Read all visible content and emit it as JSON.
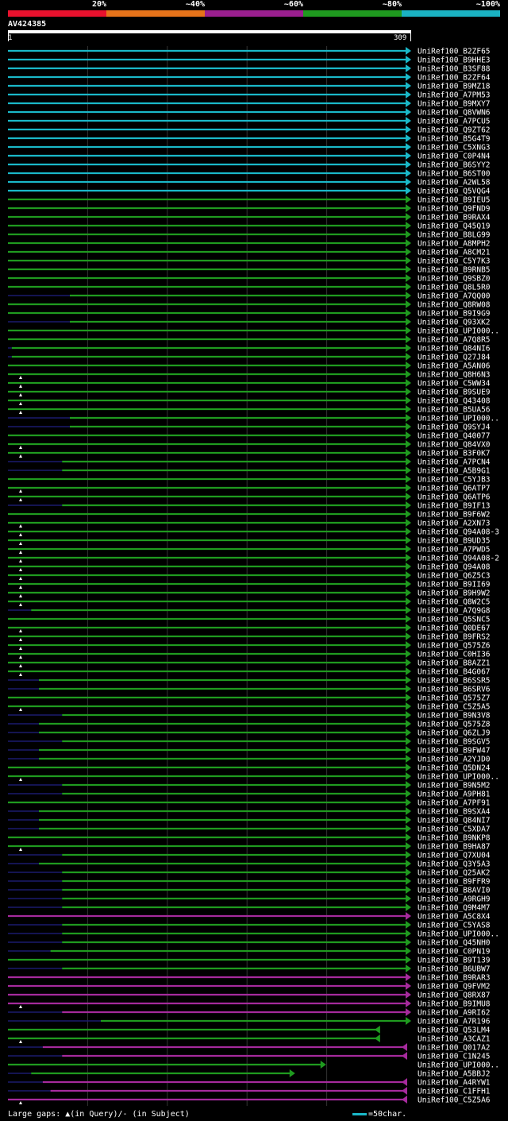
{
  "legend": {
    "labels": [
      "20%",
      "~40%",
      "~60%",
      "~80%",
      "~100%"
    ],
    "colors": [
      "#e8112d",
      "#e6731a",
      "#9b1f8f",
      "#1f9a1f",
      "#1ab2c2"
    ]
  },
  "query": {
    "name": "AV424385",
    "start": "1",
    "end": "309"
  },
  "colors": {
    "cyan": "#1ab8c8",
    "green": "#1f9a1f",
    "magenta": "#a52a9c",
    "gap": "#1a1a6e"
  },
  "hits": [
    {
      "name": "UniRef100_B2ZF65",
      "c": "cyan",
      "s": 0,
      "e": 309,
      "a": "r"
    },
    {
      "name": "UniRef100_B9HHE3",
      "c": "cyan",
      "s": 0,
      "e": 309,
      "a": "r"
    },
    {
      "name": "UniRef100_B3SF88",
      "c": "cyan",
      "s": 0,
      "e": 309,
      "a": "r"
    },
    {
      "name": "UniRef100_B2ZF64",
      "c": "cyan",
      "s": 0,
      "e": 309,
      "a": "r"
    },
    {
      "name": "UniRef100_B9MZ18",
      "c": "cyan",
      "s": 0,
      "e": 309,
      "a": "r"
    },
    {
      "name": "UniRef100_A7PM53",
      "c": "cyan",
      "s": 0,
      "e": 309,
      "a": "r"
    },
    {
      "name": "UniRef100_B9MXY7",
      "c": "cyan",
      "s": 0,
      "e": 309,
      "a": "r"
    },
    {
      "name": "UniRef100_Q8VWN6",
      "c": "cyan",
      "s": 0,
      "e": 309,
      "a": "r"
    },
    {
      "name": "UniRef100_A7PCU5",
      "c": "cyan",
      "s": 0,
      "e": 309,
      "a": "r"
    },
    {
      "name": "UniRef100_Q9ZT62",
      "c": "cyan",
      "s": 0,
      "e": 309,
      "a": "r"
    },
    {
      "name": "UniRef100_B5G4T9",
      "c": "cyan",
      "s": 0,
      "e": 309,
      "a": "r"
    },
    {
      "name": "UniRef100_C5XNG3",
      "c": "cyan",
      "s": 0,
      "e": 309,
      "a": "r"
    },
    {
      "name": "UniRef100_C0P4N4",
      "c": "cyan",
      "s": 0,
      "e": 309,
      "a": "r"
    },
    {
      "name": "UniRef100_B6SYY2",
      "c": "cyan",
      "s": 0,
      "e": 309,
      "a": "r"
    },
    {
      "name": "UniRef100_B6ST00",
      "c": "cyan",
      "s": 0,
      "e": 309,
      "a": "r"
    },
    {
      "name": "UniRef100_A2WL58",
      "c": "cyan",
      "s": 0,
      "e": 309,
      "a": "r"
    },
    {
      "name": "UniRef100_Q5VQG4",
      "c": "cyan",
      "s": 0,
      "e": 309,
      "a": "r"
    },
    {
      "name": "UniRef100_B9IEU5",
      "c": "green",
      "s": 0,
      "e": 309,
      "a": "r"
    },
    {
      "name": "UniRef100_Q9FND9",
      "c": "green",
      "s": 0,
      "e": 309,
      "a": "r"
    },
    {
      "name": "UniRef100_B9RAX4",
      "c": "green",
      "s": 0,
      "e": 309,
      "a": "r"
    },
    {
      "name": "UniRef100_Q45Q19",
      "c": "green",
      "s": 0,
      "e": 309,
      "a": "r"
    },
    {
      "name": "UniRef100_B8LG99",
      "c": "green",
      "s": 0,
      "e": 309,
      "a": "r"
    },
    {
      "name": "UniRef100_A8MPH2",
      "c": "green",
      "s": 0,
      "e": 309,
      "a": "r"
    },
    {
      "name": "UniRef100_A8CM21",
      "c": "green",
      "s": 0,
      "e": 309,
      "a": "r"
    },
    {
      "name": "UniRef100_C5Y7K3",
      "c": "green",
      "s": 0,
      "e": 309,
      "a": "r"
    },
    {
      "name": "UniRef100_B9RNB5",
      "c": "green",
      "s": 0,
      "e": 309,
      "a": "r"
    },
    {
      "name": "UniRef100_Q9SBZ0",
      "c": "green",
      "s": 0,
      "e": 309,
      "a": "r"
    },
    {
      "name": "UniRef100_Q8L5R0",
      "c": "green",
      "s": 0,
      "e": 309,
      "a": "r"
    },
    {
      "name": "UniRef100_A7QQ00",
      "c": "green",
      "s": 48,
      "e": 309,
      "a": "r"
    },
    {
      "name": "UniRef100_Q8RW08",
      "c": "green",
      "s": 0,
      "e": 309,
      "a": "r"
    },
    {
      "name": "UniRef100_B9I9G9",
      "c": "green",
      "s": 0,
      "e": 309,
      "a": "r"
    },
    {
      "name": "UniRef100_Q93XK2",
      "c": "green",
      "s": 48,
      "e": 309,
      "a": "r"
    },
    {
      "name": "UniRef100_UPI000..",
      "c": "green",
      "s": 0,
      "e": 309,
      "a": "r"
    },
    {
      "name": "UniRef100_A7Q8R5",
      "c": "green",
      "s": 0,
      "e": 309,
      "a": "r"
    },
    {
      "name": "UniRef100_Q84NI6",
      "c": "green",
      "s": 3,
      "e": 309,
      "a": "r"
    },
    {
      "name": "UniRef100_Q27J84",
      "c": "green",
      "s": 3,
      "e": 309,
      "a": "r"
    },
    {
      "name": "UniRef100_A5AN06",
      "c": "green",
      "s": 0,
      "e": 309,
      "a": "r"
    },
    {
      "name": "UniRef100_Q8H6N3",
      "c": "green",
      "s": 0,
      "e": 309,
      "a": "r",
      "g": 1
    },
    {
      "name": "UniRef100_C5WW34",
      "c": "green",
      "s": 0,
      "e": 309,
      "a": "r",
      "g": 1
    },
    {
      "name": "UniRef100_B9SUE9",
      "c": "green",
      "s": 0,
      "e": 309,
      "a": "r",
      "g": 1
    },
    {
      "name": "UniRef100_Q43408",
      "c": "green",
      "s": 0,
      "e": 309,
      "a": "r",
      "g": 1
    },
    {
      "name": "UniRef100_B5UA56",
      "c": "green",
      "s": 0,
      "e": 309,
      "a": "r",
      "g": 1
    },
    {
      "name": "UniRef100_UPI000..",
      "c": "green",
      "s": 48,
      "e": 309,
      "a": "r"
    },
    {
      "name": "UniRef100_Q9SYJ4",
      "c": "green",
      "s": 48,
      "e": 309,
      "a": "r"
    },
    {
      "name": "UniRef100_Q40077",
      "c": "green",
      "s": 0,
      "e": 309,
      "a": "r"
    },
    {
      "name": "UniRef100_Q84VX0",
      "c": "green",
      "s": 0,
      "e": 309,
      "a": "r",
      "g": 1
    },
    {
      "name": "UniRef100_B3F0K7",
      "c": "green",
      "s": 0,
      "e": 309,
      "a": "r",
      "g": 1
    },
    {
      "name": "UniRef100_A7PCN4",
      "c": "green",
      "s": 42,
      "e": 309,
      "a": "r"
    },
    {
      "name": "UniRef100_A5B9G1",
      "c": "green",
      "s": 42,
      "e": 309,
      "a": "r"
    },
    {
      "name": "UniRef100_C5YJB3",
      "c": "green",
      "s": 0,
      "e": 309,
      "a": "r"
    },
    {
      "name": "UniRef100_Q6ATP7",
      "c": "green",
      "s": 0,
      "e": 309,
      "a": "r",
      "g": 1
    },
    {
      "name": "UniRef100_Q6ATP6",
      "c": "green",
      "s": 0,
      "e": 309,
      "a": "r",
      "g": 1
    },
    {
      "name": "UniRef100_B9IF13",
      "c": "green",
      "s": 42,
      "e": 309,
      "a": "r"
    },
    {
      "name": "UniRef100_B9F6W2",
      "c": "green",
      "s": 0,
      "e": 309,
      "a": "r"
    },
    {
      "name": "UniRef100_A2XN73",
      "c": "green",
      "s": 0,
      "e": 309,
      "a": "r",
      "g": 1
    },
    {
      "name": "UniRef100_Q94A08-3",
      "c": "green",
      "s": 0,
      "e": 309,
      "a": "r",
      "g": 1
    },
    {
      "name": "UniRef100_B9UD35",
      "c": "green",
      "s": 0,
      "e": 309,
      "a": "r",
      "g": 1
    },
    {
      "name": "UniRef100_A7PWD5",
      "c": "green",
      "s": 0,
      "e": 309,
      "a": "r",
      "g": 1
    },
    {
      "name": "UniRef100_Q94A08-2",
      "c": "green",
      "s": 0,
      "e": 309,
      "a": "r",
      "g": 1
    },
    {
      "name": "UniRef100_Q94A08",
      "c": "green",
      "s": 0,
      "e": 309,
      "a": "r",
      "g": 1
    },
    {
      "name": "UniRef100_Q6Z5C3",
      "c": "green",
      "s": 0,
      "e": 309,
      "a": "r",
      "g": 1
    },
    {
      "name": "UniRef100_B9II69",
      "c": "green",
      "s": 0,
      "e": 309,
      "a": "r",
      "g": 1
    },
    {
      "name": "UniRef100_B9H9W2",
      "c": "green",
      "s": 0,
      "e": 309,
      "a": "r",
      "g": 1
    },
    {
      "name": "UniRef100_Q8W2C5",
      "c": "green",
      "s": 0,
      "e": 309,
      "a": "r",
      "g": 1
    },
    {
      "name": "UniRef100_A7Q9G8",
      "c": "green",
      "s": 18,
      "e": 309,
      "a": "r"
    },
    {
      "name": "UniRef100_Q5SNC5",
      "c": "green",
      "s": 0,
      "e": 309,
      "a": "r"
    },
    {
      "name": "UniRef100_Q0DE67",
      "c": "green",
      "s": 0,
      "e": 309,
      "a": "r",
      "g": 1
    },
    {
      "name": "UniRef100_B9FRS2",
      "c": "green",
      "s": 0,
      "e": 309,
      "a": "r",
      "g": 1
    },
    {
      "name": "UniRef100_Q575Z6",
      "c": "green",
      "s": 0,
      "e": 309,
      "a": "r",
      "g": 1
    },
    {
      "name": "UniRef100_C0HI36",
      "c": "green",
      "s": 0,
      "e": 309,
      "a": "r",
      "g": 1
    },
    {
      "name": "UniRef100_B8AZZ1",
      "c": "green",
      "s": 0,
      "e": 309,
      "a": "r",
      "g": 1
    },
    {
      "name": "UniRef100_B4G067",
      "c": "green",
      "s": 0,
      "e": 309,
      "a": "r",
      "g": 1
    },
    {
      "name": "UniRef100_B6SSR5",
      "c": "green",
      "s": 24,
      "e": 309,
      "a": "r"
    },
    {
      "name": "UniRef100_B6SRV6",
      "c": "green",
      "s": 24,
      "e": 309,
      "a": "r"
    },
    {
      "name": "UniRef100_Q575Z7",
      "c": "green",
      "s": 0,
      "e": 309,
      "a": "r"
    },
    {
      "name": "UniRef100_C5Z5A5",
      "c": "green",
      "s": 0,
      "e": 309,
      "a": "r",
      "g": 1
    },
    {
      "name": "UniRef100_B9N3V8",
      "c": "green",
      "s": 42,
      "e": 309,
      "a": "r"
    },
    {
      "name": "UniRef100_Q575Z8",
      "c": "green",
      "s": 24,
      "e": 309,
      "a": "r"
    },
    {
      "name": "UniRef100_Q6ZLJ9",
      "c": "green",
      "s": 24,
      "e": 309,
      "a": "r"
    },
    {
      "name": "UniRef100_B9SGV5",
      "c": "green",
      "s": 42,
      "e": 309,
      "a": "r"
    },
    {
      "name": "UniRef100_B9FW47",
      "c": "green",
      "s": 24,
      "e": 309,
      "a": "r"
    },
    {
      "name": "UniRef100_A2YJD0",
      "c": "green",
      "s": 24,
      "e": 309,
      "a": "r"
    },
    {
      "name": "UniRef100_Q5DN24",
      "c": "green",
      "s": 0,
      "e": 309,
      "a": "r"
    },
    {
      "name": "UniRef100_UPI000..",
      "c": "green",
      "s": 0,
      "e": 309,
      "a": "r",
      "g": 1
    },
    {
      "name": "UniRef100_B9N5M2",
      "c": "green",
      "s": 42,
      "e": 309,
      "a": "r"
    },
    {
      "name": "UniRef100_A9PH81",
      "c": "green",
      "s": 42,
      "e": 309,
      "a": "r"
    },
    {
      "name": "UniRef100_A7PF91",
      "c": "green",
      "s": 0,
      "e": 309,
      "a": "r"
    },
    {
      "name": "UniRef100_B9SXA4",
      "c": "green",
      "s": 24,
      "e": 309,
      "a": "r"
    },
    {
      "name": "UniRef100_Q84NI7",
      "c": "green",
      "s": 24,
      "e": 309,
      "a": "r"
    },
    {
      "name": "UniRef100_C5XDA7",
      "c": "green",
      "s": 24,
      "e": 309,
      "a": "r"
    },
    {
      "name": "UniRef100_B9NKP8",
      "c": "green",
      "s": 0,
      "e": 309,
      "a": "r"
    },
    {
      "name": "UniRef100_B9HA87",
      "c": "green",
      "s": 0,
      "e": 309,
      "a": "r",
      "g": 1
    },
    {
      "name": "UniRef100_Q7XU04",
      "c": "green",
      "s": 42,
      "e": 309,
      "a": "r"
    },
    {
      "name": "UniRef100_Q3Y5A3",
      "c": "green",
      "s": 24,
      "e": 309,
      "a": "r"
    },
    {
      "name": "UniRef100_Q25AK2",
      "c": "green",
      "s": 42,
      "e": 309,
      "a": "r"
    },
    {
      "name": "UniRef100_B9FFR9",
      "c": "green",
      "s": 42,
      "e": 309,
      "a": "r"
    },
    {
      "name": "UniRef100_B8AVI0",
      "c": "green",
      "s": 42,
      "e": 309,
      "a": "r"
    },
    {
      "name": "UniRef100_A9RGH9",
      "c": "green",
      "s": 42,
      "e": 309,
      "a": "r"
    },
    {
      "name": "UniRef100_Q9M4M7",
      "c": "green",
      "s": 42,
      "e": 309,
      "a": "r"
    },
    {
      "name": "UniRef100_A5C8X4",
      "c": "magenta",
      "s": 0,
      "e": 309,
      "a": "r"
    },
    {
      "name": "UniRef100_C5YAS8",
      "c": "green",
      "s": 42,
      "e": 309,
      "a": "r"
    },
    {
      "name": "UniRef100_UPI000..",
      "c": "green",
      "s": 42,
      "e": 309,
      "a": "r"
    },
    {
      "name": "UniRef100_Q45NH0",
      "c": "green",
      "s": 42,
      "e": 309,
      "a": "r"
    },
    {
      "name": "UniRef100_C0PN19",
      "c": "green",
      "s": 33,
      "e": 309,
      "a": "r"
    },
    {
      "name": "UniRef100_B9T139",
      "c": "green",
      "s": 0,
      "e": 309,
      "a": "r"
    },
    {
      "name": "UniRef100_B6UBW7",
      "c": "green",
      "s": 42,
      "e": 309,
      "a": "r"
    },
    {
      "name": "UniRef100_B9RAR3",
      "c": "magenta",
      "s": 0,
      "e": 309,
      "a": "r"
    },
    {
      "name": "UniRef100_Q9FVM2",
      "c": "magenta",
      "s": 0,
      "e": 309,
      "a": "r"
    },
    {
      "name": "UniRef100_Q8RX87",
      "c": "magenta",
      "s": 0,
      "e": 309,
      "a": "r"
    },
    {
      "name": "UniRef100_B9IMU8",
      "c": "magenta",
      "s": 0,
      "e": 309,
      "a": "r",
      "g": 1
    },
    {
      "name": "UniRef100_A9RI62",
      "c": "magenta",
      "s": 42,
      "e": 309,
      "a": "r"
    },
    {
      "name": "UniRef100_A7R196",
      "c": "green",
      "s": 72,
      "e": 309,
      "a": "r"
    },
    {
      "name": "UniRef100_Q53LM4",
      "c": "green",
      "s": 0,
      "e": 288,
      "a": "l"
    },
    {
      "name": "UniRef100_A3CAZ1",
      "c": "green",
      "s": 0,
      "e": 288,
      "a": "l",
      "g": 1
    },
    {
      "name": "UniRef100_Q017A2",
      "c": "magenta",
      "s": 27,
      "e": 309,
      "a": "l"
    },
    {
      "name": "UniRef100_C1N245",
      "c": "magenta",
      "s": 42,
      "e": 309,
      "a": "l"
    },
    {
      "name": "UniRef100_UPI000..",
      "c": "green",
      "s": 0,
      "e": 243,
      "a": "r"
    },
    {
      "name": "UniRef100_A5BBJ2",
      "c": "green",
      "s": 18,
      "e": 219,
      "a": "r"
    },
    {
      "name": "UniRef100_A4RYW1",
      "c": "magenta",
      "s": 27,
      "e": 309,
      "a": "l"
    },
    {
      "name": "UniRef100_C1FFH1",
      "c": "magenta",
      "s": 33,
      "e": 309,
      "a": "l"
    },
    {
      "name": "UniRef100_C5Z5A6",
      "c": "magenta",
      "s": 0,
      "e": 309,
      "a": "l",
      "g": 1
    }
  ],
  "footer": {
    "gaps_text": "Large gaps: ▲(in Query)/- (in Subject)",
    "scale_text": "=50char."
  }
}
